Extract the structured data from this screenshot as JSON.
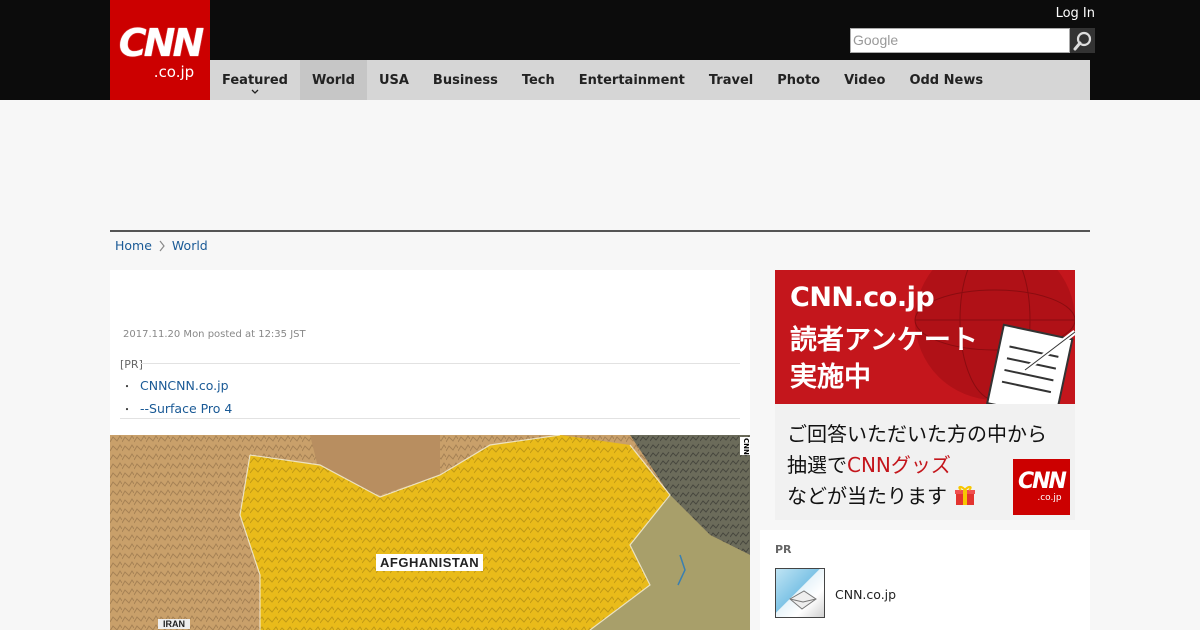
{
  "header": {
    "logo_main": "CNN",
    "logo_sub": ".co.jp",
    "login_label": "Log In",
    "search_placeholder": "Google"
  },
  "nav": {
    "items": [
      {
        "label": "Featured",
        "active": false
      },
      {
        "label": "World",
        "active": true
      },
      {
        "label": "USA",
        "active": false
      },
      {
        "label": "Business",
        "active": false
      },
      {
        "label": "Tech",
        "active": false
      },
      {
        "label": "Entertainment",
        "active": false
      },
      {
        "label": "Travel",
        "active": false
      },
      {
        "label": "Photo",
        "active": false
      },
      {
        "label": "Video",
        "active": false
      },
      {
        "label": "Odd News",
        "active": false
      }
    ]
  },
  "breadcrumb": {
    "home": "Home",
    "current": "World"
  },
  "article": {
    "date": "2017.11.20 Mon posted at 12:35 JST",
    "pr_label": "[PR]",
    "pr_links": [
      "CNNCNN.co.jp",
      "--Surface Pro 4"
    ],
    "map_label_main": "AFGHANISTAN",
    "map_label_side": "IRAN",
    "map_bug": "CNN"
  },
  "sidebar": {
    "banner_title": "CNN.co.jp",
    "banner_line2": "読者アンケート",
    "banner_line3": "実施中",
    "banner_sub1": "ご回答いただいた方の中から",
    "banner_sub2_a": "抽選で",
    "banner_sub2_b": "CNNグッズ",
    "banner_sub3": "などが当たります",
    "mini_logo_main": "CNN",
    "mini_logo_sub": ".co.jp",
    "pr_heading": "PR",
    "pr_item": "CNN.co.jp"
  },
  "colors": {
    "brand_red": "#cc0000",
    "header_bg": "#0c0c0c",
    "nav_bg": "#d6d6d6",
    "link_blue": "#1a5a96"
  }
}
